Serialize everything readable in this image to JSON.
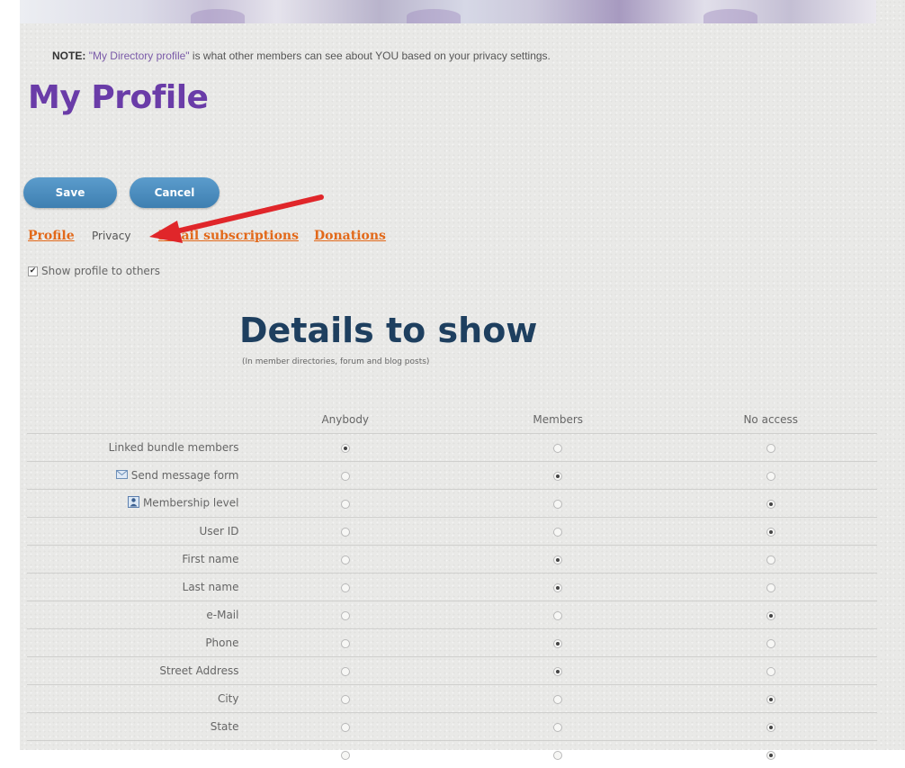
{
  "note": {
    "label": "NOTE:",
    "quoted": "\"My Directory profile\"",
    "text": " is what other members can see about YOU based on your privacy settings."
  },
  "page_title": "My Profile",
  "buttons": {
    "save": "Save",
    "cancel": "Cancel"
  },
  "tabs": {
    "profile": "Profile",
    "privacy": "Privacy",
    "email_subscriptions": "Email subscriptions",
    "donations": "Donations"
  },
  "show_profile": {
    "label": "Show profile to others",
    "checked": true
  },
  "details": {
    "heading": "Details to show",
    "subheading": "(In member directories, forum and blog posts)"
  },
  "table": {
    "columns": [
      "Anybody",
      "Members",
      "No access"
    ],
    "rows": [
      {
        "label": "Linked bundle members",
        "icon": "",
        "selected": 0
      },
      {
        "label": "Send message form",
        "icon": "envelope-icon",
        "selected": 1
      },
      {
        "label": "Membership level",
        "icon": "member-badge-icon",
        "selected": 2
      },
      {
        "label": "User ID",
        "icon": "",
        "selected": 2
      },
      {
        "label": "First name",
        "icon": "",
        "selected": 1
      },
      {
        "label": "Last name",
        "icon": "",
        "selected": 1
      },
      {
        "label": "e-Mail",
        "icon": "",
        "selected": 2
      },
      {
        "label": "Phone",
        "icon": "",
        "selected": 1
      },
      {
        "label": "Street Address",
        "icon": "",
        "selected": 1
      },
      {
        "label": "City",
        "icon": "",
        "selected": 2
      },
      {
        "label": "State",
        "icon": "",
        "selected": 2
      },
      {
        "label": "",
        "icon": "",
        "selected": 2
      }
    ]
  },
  "colors": {
    "title_purple": "#6a3ca8",
    "tab_orange": "#e2691a",
    "button_blue": "#3e7fb1",
    "heading_navy": "#1e3f5f",
    "arrow_red": "#e0262a"
  }
}
